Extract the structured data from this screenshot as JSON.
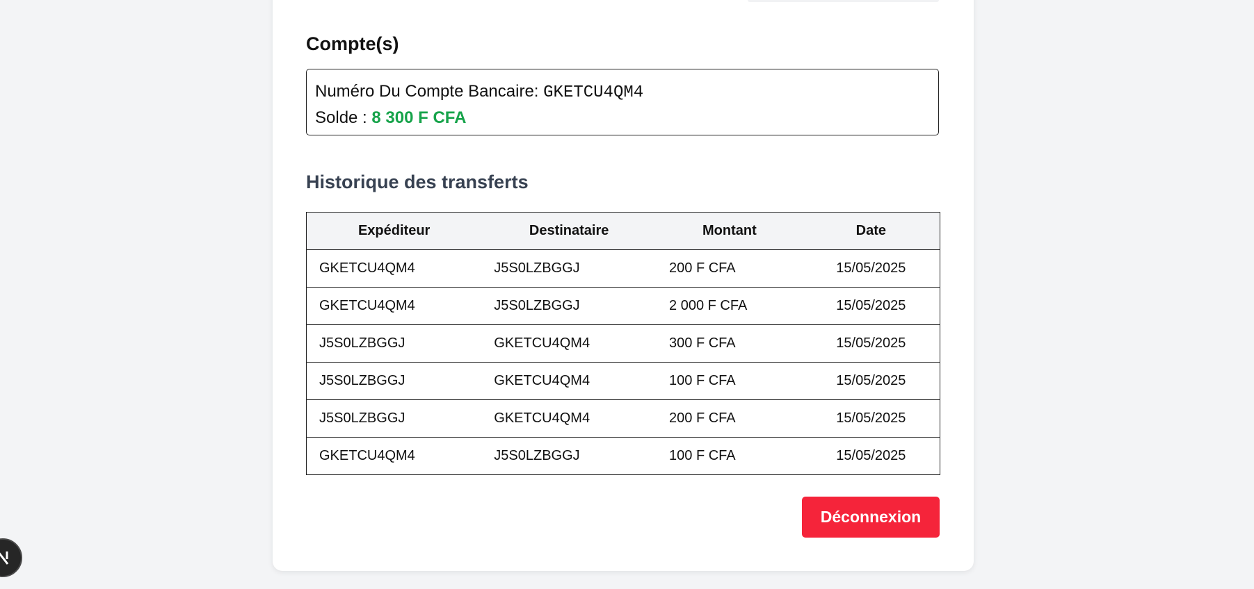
{
  "account_section": {
    "title": "Compte(s)",
    "account_label": "Numéro Du Compte Bancaire: ",
    "account_number": "GKETCU4QM4",
    "balance_label": "Solde : ",
    "balance_value": "8 300 F CFA"
  },
  "history": {
    "title": "Historique des transferts",
    "columns": [
      "Expéditeur",
      "Destinataire",
      "Montant",
      "Date"
    ],
    "rows": [
      [
        "GKETCU4QM4",
        "J5S0LZBGGJ",
        "200 F CFA",
        "15/05/2025"
      ],
      [
        "GKETCU4QM4",
        "J5S0LZBGGJ",
        "2 000 F CFA",
        "15/05/2025"
      ],
      [
        "J5S0LZBGGJ",
        "GKETCU4QM4",
        "300 F CFA",
        "15/05/2025"
      ],
      [
        "J5S0LZBGGJ",
        "GKETCU4QM4",
        "100 F CFA",
        "15/05/2025"
      ],
      [
        "J5S0LZBGGJ",
        "GKETCU4QM4",
        "200 F CFA",
        "15/05/2025"
      ],
      [
        "GKETCU4QM4",
        "J5S0LZBGGJ",
        "100 F CFA",
        "15/05/2025"
      ]
    ]
  },
  "actions": {
    "logout_label": "Déconnexion"
  },
  "dev_badge": {
    "icon": "nextjs-n-icon"
  },
  "colors": {
    "balance": "#16a34a",
    "logout": "#f5243a",
    "history_title": "#374151"
  }
}
